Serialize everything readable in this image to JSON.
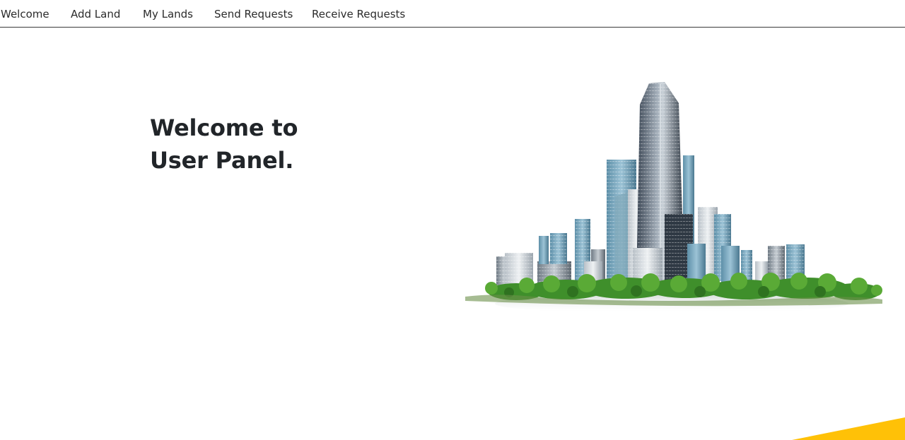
{
  "nav": {
    "items": [
      {
        "label": "Welcome"
      },
      {
        "label": "Add Land"
      },
      {
        "label": "My Lands"
      },
      {
        "label": "Send Requests"
      },
      {
        "label": "Receive Requests"
      }
    ]
  },
  "hero": {
    "title_line1": "Welcome to",
    "title_line2": "User Panel."
  },
  "colors": {
    "accent": "#ffc107",
    "text": "#212529"
  },
  "icons": {
    "hero_image": "city-skyline-illustration",
    "corner": "yellow-corner-accent"
  }
}
